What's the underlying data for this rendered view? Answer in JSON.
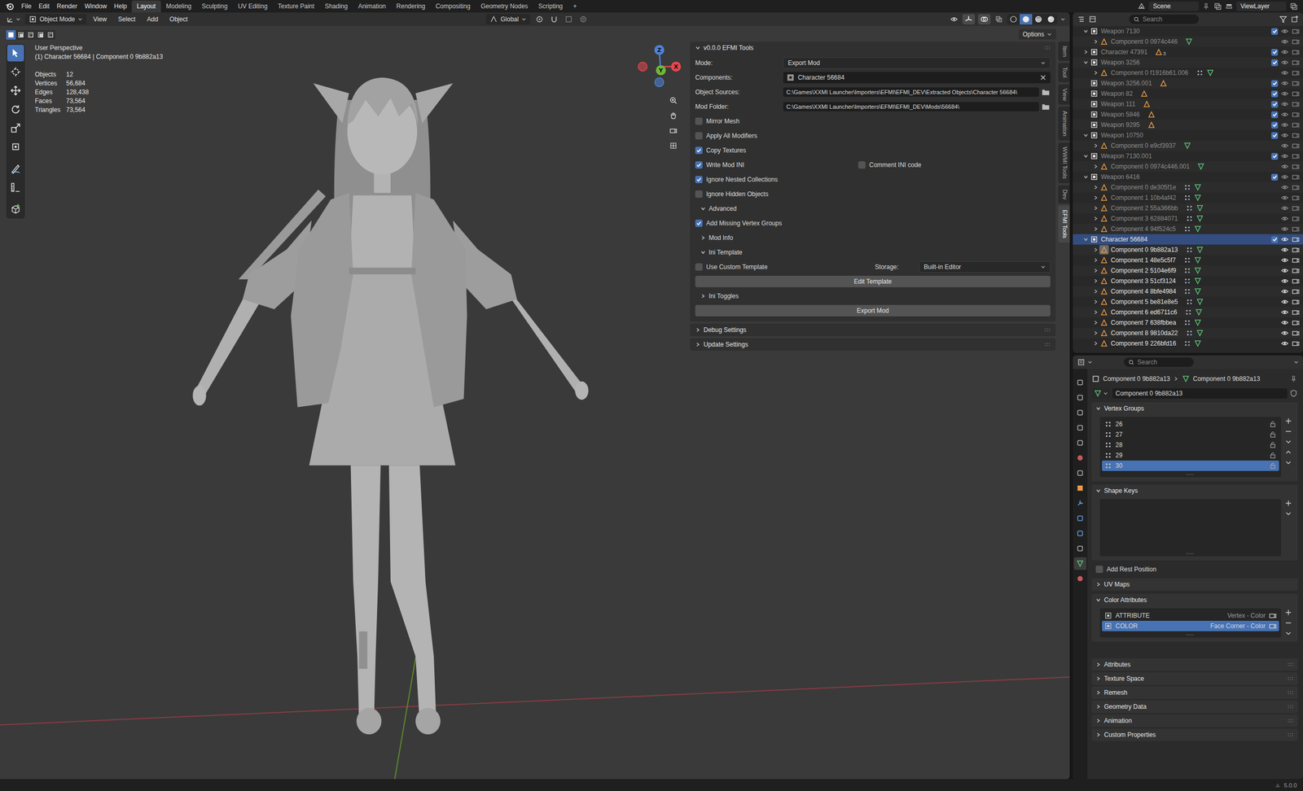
{
  "topbar": {
    "menus": [
      "File",
      "Edit",
      "Render",
      "Window",
      "Help"
    ],
    "workspaces": [
      {
        "label": "Layout",
        "selected": true
      },
      {
        "label": "Modeling",
        "selected": false
      },
      {
        "label": "Sculpting",
        "selected": false
      },
      {
        "label": "UV Editing",
        "selected": false
      },
      {
        "label": "Texture Paint",
        "selected": false
      },
      {
        "label": "Shading",
        "selected": false
      },
      {
        "label": "Animation",
        "selected": false
      },
      {
        "label": "Rendering",
        "selected": false
      },
      {
        "label": "Compositing",
        "selected": false
      },
      {
        "label": "Geometry Nodes",
        "selected": false
      },
      {
        "label": "Scripting",
        "selected": false
      }
    ],
    "add_workspace": "+",
    "scene": "Scene",
    "view_layer": "ViewLayer"
  },
  "viewport": {
    "header": {
      "mode": "Object Mode",
      "menus": [
        "View",
        "Select",
        "Add",
        "Object"
      ],
      "orientation": "Global",
      "shading": [
        {
          "kind": "wireframe",
          "selected": false
        },
        {
          "kind": "solid",
          "selected": true
        },
        {
          "kind": "material",
          "selected": false
        },
        {
          "kind": "rendered",
          "selected": false
        }
      ]
    },
    "options": "Options",
    "select_modes": [
      {
        "kind": "set",
        "selected": true
      },
      {
        "kind": "extend",
        "selected": false
      },
      {
        "kind": "subtract",
        "selected": false
      },
      {
        "kind": "invert",
        "selected": false
      },
      {
        "kind": "intersect",
        "selected": false
      }
    ],
    "tools": [
      {
        "kind": "select",
        "selected": true
      },
      {
        "kind": "cursor",
        "selected": false
      },
      {
        "kind": "move",
        "selected": false
      },
      {
        "kind": "rotate",
        "selected": false
      },
      {
        "kind": "scale",
        "selected": false
      },
      {
        "kind": "transform",
        "selected": false
      },
      {
        "kind": "annotate",
        "selected": false
      },
      {
        "kind": "measure",
        "selected": false
      },
      {
        "kind": "add",
        "selected": false
      }
    ],
    "overlay": {
      "view": "User Perspective",
      "context": "(1) Character 56684 | Component 0 9b882a13",
      "stats": [
        {
          "label": "Objects",
          "value": "12"
        },
        {
          "label": "Vertices",
          "value": "56,684"
        },
        {
          "label": "Edges",
          "value": "128,438"
        },
        {
          "label": "Faces",
          "value": "73,564"
        },
        {
          "label": "Triangles",
          "value": "73,564"
        }
      ]
    },
    "gizmo": {
      "axes": [
        {
          "label": "X",
          "color": "#e4474f"
        },
        {
          "label": "Y",
          "color": "#6fb83a"
        },
        {
          "label": "Z",
          "color": "#4f83d8"
        }
      ]
    },
    "sidebar_tabs": [
      {
        "label": "Item",
        "selected": false
      },
      {
        "label": "Tool",
        "selected": false
      },
      {
        "label": "View",
        "selected": false
      },
      {
        "label": "Animation",
        "selected": false
      },
      {
        "label": "WWMI Tools",
        "selected": false
      },
      {
        "label": "Dev",
        "selected": false
      },
      {
        "label": "EFMI Tools",
        "selected": true
      }
    ],
    "efmi": {
      "title": "v0.0.0 EFMI Tools",
      "expanded": true,
      "rows": [
        {
          "kind": "dropdown",
          "label": "Mode:",
          "value": "Export Mod"
        },
        {
          "kind": "datablock",
          "label": "Components:",
          "value": "Character 56684"
        },
        {
          "kind": "path",
          "label": "Object Sources:",
          "value": "C:\\Games\\XXMI Launcher\\Importers\\EFMI\\EFMI_DEV\\Extracted Objects\\Character 56684\\"
        },
        {
          "kind": "path",
          "label": "Mod Folder:",
          "value": "C:\\Games\\XXMI Launcher\\Importers\\EFMI\\EFMI_DEV\\Mods\\56684\\"
        },
        {
          "kind": "checkbox",
          "label": "Mirror Mesh",
          "checked": false
        },
        {
          "kind": "checkbox",
          "label": "Apply All Modifiers",
          "checked": false
        },
        {
          "kind": "checkbox",
          "label": "Copy Textures",
          "checked": true
        },
        {
          "kind": "checkbox-pair",
          "items": [
            {
              "label": "Write Mod INI",
              "checked": true
            },
            {
              "label": "Comment INI code",
              "checked": false
            }
          ]
        },
        {
          "kind": "checkbox",
          "label": "Ignore Nested Collections",
          "checked": true
        },
        {
          "kind": "checkbox",
          "label": "Ignore Hidden Objects",
          "checked": false
        },
        {
          "kind": "subpanel",
          "label": "Advanced",
          "expanded": true
        },
        {
          "kind": "checkbox",
          "label": "Add Missing Vertex Groups",
          "checked": true
        },
        {
          "kind": "subpanel",
          "label": "Mod Info",
          "expanded": false
        },
        {
          "kind": "subpanel",
          "label": "Ini Template",
          "expanded": true
        },
        {
          "kind": "checkbox-dropdown",
          "label": "Use Custom Template",
          "checked": false,
          "dropdown_label": "Storage:",
          "value": "Built-in Editor"
        },
        {
          "kind": "button",
          "label": "Edit Template"
        },
        {
          "kind": "subpanel",
          "label": "Ini Toggles",
          "expanded": false
        },
        {
          "kind": "button",
          "label": "Export Mod"
        }
      ]
    },
    "panels": [
      {
        "label": "Debug Settings",
        "expanded": false
      },
      {
        "label": "Update Settings",
        "expanded": false
      }
    ]
  },
  "outliner": {
    "search_placeholder": "Search",
    "rows": [
      {
        "label": "Weapon 7130",
        "kind": "collection",
        "depth": 0,
        "expandable": true,
        "expanded": true,
        "dimmed": true,
        "selected": false,
        "enabled": true
      },
      {
        "label": "Component 0 0974c446",
        "kind": "object",
        "depth": 1,
        "expandable": true,
        "expanded": false,
        "dimmed": true,
        "selected": false,
        "active": false,
        "modifiers": false
      },
      {
        "label": "Character 47391",
        "kind": "collection",
        "depth": 0,
        "expandable": true,
        "expanded": false,
        "dimmed": true,
        "selected": false,
        "enabled": true,
        "badge": "3"
      },
      {
        "label": "Weapon 3256",
        "kind": "collection",
        "depth": 0,
        "expandable": true,
        "expanded": true,
        "dimmed": true,
        "selected": false,
        "enabled": true
      },
      {
        "label": "Component 0 f1916b61.006",
        "kind": "object",
        "depth": 1,
        "expandable": true,
        "expanded": false,
        "dimmed": true,
        "selected": false,
        "active": false,
        "modifiers": true
      },
      {
        "label": "Weapon 3256.001",
        "kind": "collection",
        "depth": 0,
        "expandable": false,
        "expanded": false,
        "dimmed": true,
        "selected": false,
        "enabled": true
      },
      {
        "label": "Weapon 82",
        "kind": "collection",
        "depth": 0,
        "expandable": false,
        "expanded": false,
        "dimmed": true,
        "selected": false,
        "enabled": true
      },
      {
        "label": "Weapon 111",
        "kind": "collection",
        "depth": 0,
        "expandable": false,
        "expanded": false,
        "dimmed": true,
        "selected": false,
        "enabled": true
      },
      {
        "label": "Weapon 5846",
        "kind": "collection",
        "depth": 0,
        "expandable": false,
        "expanded": false,
        "dimmed": true,
        "selected": false,
        "enabled": true
      },
      {
        "label": "Weapon 9295",
        "kind": "collection",
        "depth": 0,
        "expandable": false,
        "expanded": false,
        "dimmed": true,
        "selected": false,
        "enabled": true
      },
      {
        "label": "Weapon 10750",
        "kind": "collection",
        "depth": 0,
        "expandable": true,
        "expanded": true,
        "dimmed": true,
        "selected": false,
        "enabled": true
      },
      {
        "label": "Component 0 e9cf3937",
        "kind": "object",
        "depth": 1,
        "expandable": true,
        "expanded": false,
        "dimmed": true,
        "selected": false,
        "active": false,
        "modifiers": false
      },
      {
        "label": "Weapon 7130.001",
        "kind": "collection",
        "depth": 0,
        "expandable": true,
        "expanded": true,
        "dimmed": true,
        "selected": false,
        "enabled": true
      },
      {
        "label": "Component 0 0974c446.001",
        "kind": "object",
        "depth": 1,
        "expandable": true,
        "expanded": false,
        "dimmed": true,
        "selected": false,
        "active": false,
        "modifiers": false
      },
      {
        "label": "Weapon 6416",
        "kind": "collection",
        "depth": 0,
        "expandable": true,
        "expanded": true,
        "dimmed": true,
        "selected": false,
        "enabled": true
      },
      {
        "label": "Component 0 de305f1e",
        "kind": "object",
        "depth": 1,
        "expandable": true,
        "expanded": false,
        "dimmed": true,
        "selected": false,
        "active": false,
        "modifiers": true
      },
      {
        "label": "Component 1 10b4af42",
        "kind": "object",
        "depth": 1,
        "expandable": true,
        "expanded": false,
        "dimmed": true,
        "selected": false,
        "active": false,
        "modifiers": true
      },
      {
        "label": "Component 2 55a366bb",
        "kind": "object",
        "depth": 1,
        "expandable": true,
        "expanded": false,
        "dimmed": true,
        "selected": false,
        "active": false,
        "modifiers": true
      },
      {
        "label": "Component 3 62884071",
        "kind": "object",
        "depth": 1,
        "expandable": true,
        "expanded": false,
        "dimmed": true,
        "selected": false,
        "active": false,
        "modifiers": true
      },
      {
        "label": "Component 4 94f524c5",
        "kind": "object",
        "depth": 1,
        "expandable": true,
        "expanded": false,
        "dimmed": true,
        "selected": false,
        "active": false,
        "modifiers": true
      },
      {
        "label": "Character 56684",
        "kind": "collection",
        "depth": 0,
        "expandable": true,
        "expanded": true,
        "dimmed": false,
        "selected": true,
        "enabled": true
      },
      {
        "label": "Component 0 9b882a13",
        "kind": "object",
        "depth": 1,
        "expandable": true,
        "expanded": false,
        "dimmed": false,
        "selected": false,
        "active": true,
        "modifiers": true
      },
      {
        "label": "Component 1 48e5c5f7",
        "kind": "object",
        "depth": 1,
        "expandable": true,
        "expanded": false,
        "dimmed": false,
        "selected": false,
        "active": false,
        "modifiers": true
      },
      {
        "label": "Component 2 5104e6f9",
        "kind": "object",
        "depth": 1,
        "expandable": true,
        "expanded": false,
        "dimmed": false,
        "selected": false,
        "active": false,
        "modifiers": true
      },
      {
        "label": "Component 3 51cf3124",
        "kind": "object",
        "depth": 1,
        "expandable": true,
        "expanded": false,
        "dimmed": false,
        "selected": false,
        "active": false,
        "modifiers": true
      },
      {
        "label": "Component 4 8bfe4984",
        "kind": "object",
        "depth": 1,
        "expandable": true,
        "expanded": false,
        "dimmed": false,
        "selected": false,
        "active": false,
        "modifiers": true
      },
      {
        "label": "Component 5 be81e8e5",
        "kind": "object",
        "depth": 1,
        "expandable": true,
        "expanded": false,
        "dimmed": false,
        "selected": false,
        "active": false,
        "modifiers": true
      },
      {
        "label": "Component 6 ed6711c6",
        "kind": "object",
        "depth": 1,
        "expandable": true,
        "expanded": false,
        "dimmed": false,
        "selected": false,
        "active": false,
        "modifiers": true
      },
      {
        "label": "Component 7 638fbbea",
        "kind": "object",
        "depth": 1,
        "expandable": true,
        "expanded": false,
        "dimmed": false,
        "selected": false,
        "active": false,
        "modifiers": true
      },
      {
        "label": "Component 8 9810da22",
        "kind": "object",
        "depth": 1,
        "expandable": true,
        "expanded": false,
        "dimmed": false,
        "selected": false,
        "active": false,
        "modifiers": true
      },
      {
        "label": "Component 9 226bfd16",
        "kind": "object",
        "depth": 1,
        "expandable": true,
        "expanded": false,
        "dimmed": false,
        "selected": false,
        "active": false,
        "modifiers": true
      }
    ]
  },
  "properties": {
    "search_placeholder": "Search",
    "tabs": [
      {
        "kind": "tool",
        "selected": false
      },
      {
        "kind": "render",
        "selected": false
      },
      {
        "kind": "output",
        "selected": false
      },
      {
        "kind": "view-layer",
        "selected": false
      },
      {
        "kind": "scene",
        "selected": false
      },
      {
        "kind": "world",
        "selected": false
      },
      {
        "kind": "collection",
        "selected": false
      },
      {
        "kind": "object",
        "selected": false
      },
      {
        "kind": "modifier",
        "selected": false
      },
      {
        "kind": "particles",
        "selected": false
      },
      {
        "kind": "physics",
        "selected": false
      },
      {
        "kind": "constraints",
        "selected": false
      },
      {
        "kind": "data",
        "selected": true
      },
      {
        "kind": "material",
        "selected": false
      }
    ],
    "breadcrumb": [
      "Component 0 9b882a13",
      "Component 0 9b882a13"
    ],
    "datablock": "Component 0 9b882a13",
    "vertex_groups": {
      "label": "Vertex Groups",
      "expanded": true,
      "items": [
        {
          "name": "26",
          "selected": false
        },
        {
          "name": "27",
          "selected": false
        },
        {
          "name": "28",
          "selected": false
        },
        {
          "name": "29",
          "selected": false
        },
        {
          "name": "30",
          "selected": true
        }
      ]
    },
    "shape_keys": {
      "label": "Shape Keys",
      "expanded": true
    },
    "rest_position": {
      "label": "Add Rest Position",
      "checked": false
    },
    "uv_maps": {
      "label": "UV Maps",
      "expanded": false
    },
    "color_attributes": {
      "label": "Color Attributes",
      "expanded": true,
      "items": [
        {
          "name": "ATTRIBUTE",
          "info": "Vertex - Color",
          "selected": false
        },
        {
          "name": "COLOR",
          "info": "Face Corner - Color",
          "selected": true
        }
      ]
    },
    "panels": [
      {
        "label": "Attributes",
        "expanded": false
      },
      {
        "label": "Texture Space",
        "expanded": false
      },
      {
        "label": "Remesh",
        "expanded": false
      },
      {
        "label": "Geometry Data",
        "expanded": false
      },
      {
        "label": "Animation",
        "expanded": false
      },
      {
        "label": "Custom Properties",
        "expanded": false
      }
    ]
  },
  "status_bar": {
    "version": "5.0.0"
  }
}
